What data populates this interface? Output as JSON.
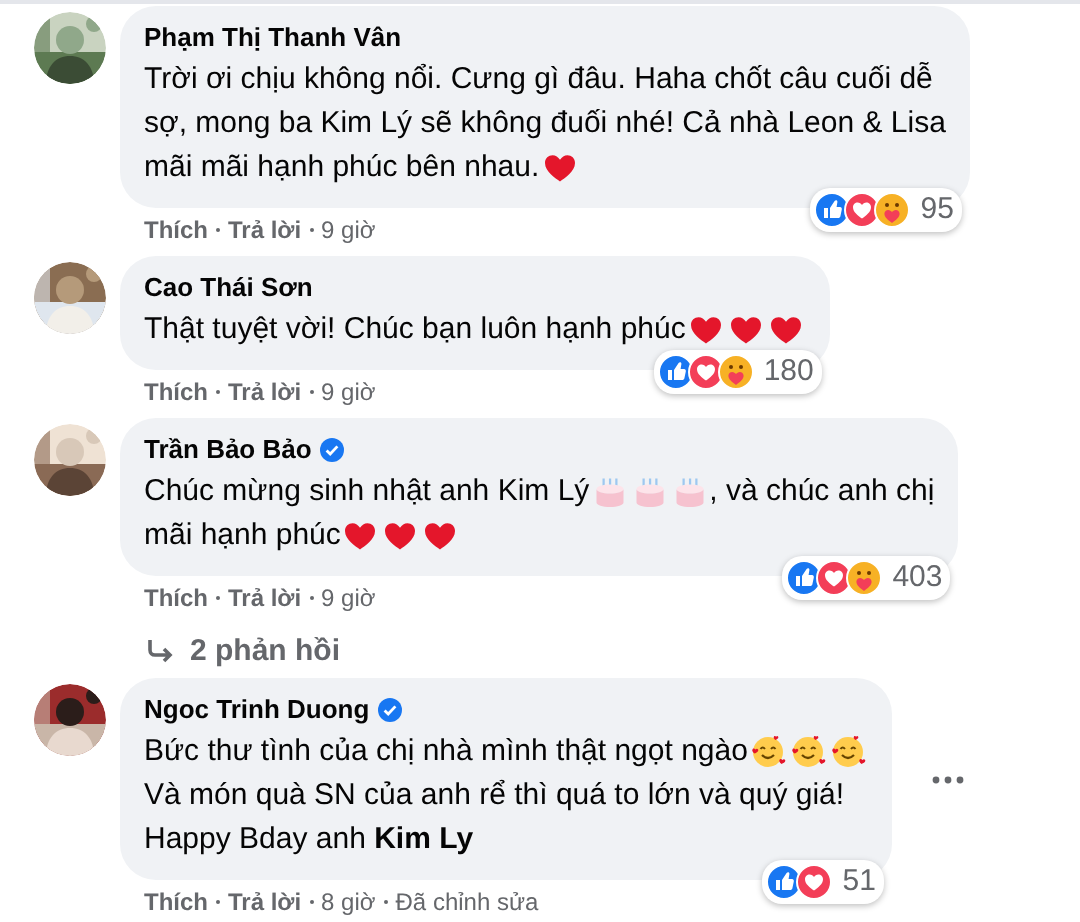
{
  "comments": [
    {
      "author": "Phạm Thị Thanh Vân",
      "verified": false,
      "show_menu": false,
      "lines": [
        [
          {
            "kind": "text",
            "text": "Trời ơi chịu không nổi. Cưng gì đâu. Haha chốt câu cuối dễ"
          }
        ],
        [
          {
            "kind": "text",
            "text": "sợ, mong ba Kim Lý sẽ không đuối nhé! Cả nhà Leon & Lisa"
          }
        ],
        [
          {
            "kind": "text",
            "text": "mãi mãi hạnh phúc bên nhau."
          },
          {
            "kind": "heart"
          }
        ]
      ],
      "actions": {
        "like": "Thích",
        "reply": "Trả lời",
        "time": "9 giờ"
      },
      "reactions": [
        {
          "kind": "like"
        },
        {
          "kind": "love"
        },
        {
          "kind": "care"
        }
      ],
      "reaction_count": "95"
    },
    {
      "author": "Cao Thái Sơn",
      "verified": false,
      "show_menu": false,
      "lines": [
        [
          {
            "kind": "text",
            "text": "Thật tuyệt vời! Chúc bạn luôn hạnh phúc"
          },
          {
            "kind": "heart"
          },
          {
            "kind": "heart"
          },
          {
            "kind": "heart"
          }
        ]
      ],
      "actions": {
        "like": "Thích",
        "reply": "Trả lời",
        "time": "9 giờ"
      },
      "reactions": [
        {
          "kind": "like"
        },
        {
          "kind": "love"
        },
        {
          "kind": "care"
        }
      ],
      "reaction_count": "180"
    },
    {
      "author": "Trần Bảo Bảo",
      "verified": true,
      "show_menu": false,
      "lines": [
        [
          {
            "kind": "text",
            "text": "Chúc mừng sinh nhật anh Kim Lý"
          },
          {
            "kind": "cake"
          },
          {
            "kind": "cake"
          },
          {
            "kind": "cake"
          },
          {
            "kind": "text",
            "text": ", và chúc anh chị"
          }
        ],
        [
          {
            "kind": "text",
            "text": "mãi hạnh phúc"
          },
          {
            "kind": "heart"
          },
          {
            "kind": "heart"
          },
          {
            "kind": "heart"
          }
        ]
      ],
      "actions": {
        "like": "Thích",
        "reply": "Trả lời",
        "time": "9 giờ"
      },
      "reactions": [
        {
          "kind": "like"
        },
        {
          "kind": "love"
        },
        {
          "kind": "care"
        }
      ],
      "reaction_count": "403",
      "replies": "2 phản hồi"
    },
    {
      "author": "Ngoc Trinh Duong",
      "verified": true,
      "show_menu": true,
      "lines": [
        [
          {
            "kind": "text",
            "text": "Bức thư tình của chị nhà mình thật ngọt ngào"
          },
          {
            "kind": "smiley"
          },
          {
            "kind": "smiley"
          },
          {
            "kind": "smiley"
          }
        ],
        [
          {
            "kind": "text",
            "text": "Và món quà SN của anh rể thì quá to lớn và quý giá!"
          }
        ],
        [
          {
            "kind": "text",
            "text": "Happy Bday anh **Kim Ly**"
          }
        ]
      ],
      "actions": {
        "like": "Thích",
        "reply": "Trả lời",
        "time": "8 giờ",
        "edited": "Đã chỉnh sửa"
      },
      "reactions": [
        {
          "kind": "like"
        },
        {
          "kind": "love"
        }
      ],
      "reaction_count": "51"
    }
  ]
}
